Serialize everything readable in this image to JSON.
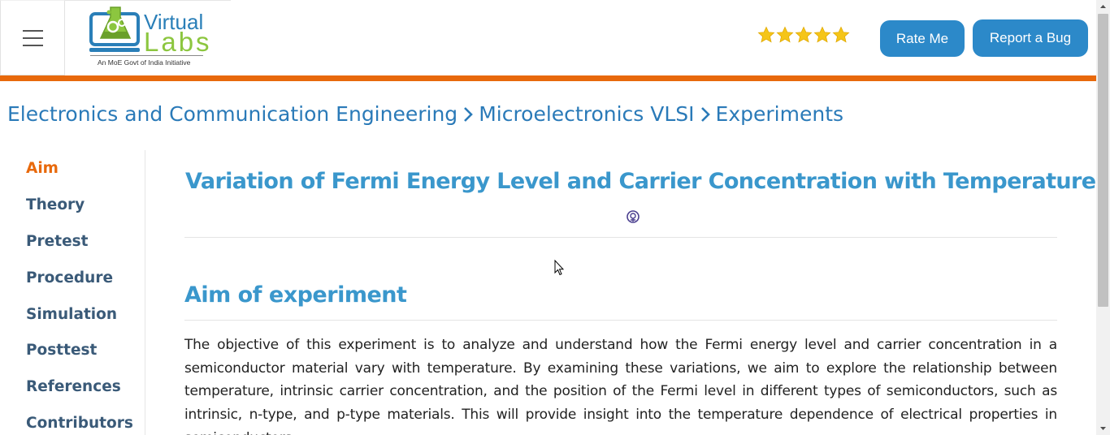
{
  "header": {
    "logo": {
      "word1": "Virtual",
      "word2": "Labs",
      "tagline": "An MoE Govt of India Initiative"
    },
    "rating_stars": 5,
    "rate_button": "Rate Me",
    "bug_button": "Report a Bug",
    "accent_color": "#e8690c",
    "button_color": "#2c89c9"
  },
  "breadcrumb": {
    "items": [
      "Electronics and Communication Engineering",
      "Microelectronics VLSI",
      "Experiments"
    ]
  },
  "sidebar": {
    "items": [
      {
        "label": "Aim",
        "active": true
      },
      {
        "label": "Theory",
        "active": false
      },
      {
        "label": "Pretest",
        "active": false
      },
      {
        "label": "Procedure",
        "active": false
      },
      {
        "label": "Simulation",
        "active": false
      },
      {
        "label": "Posttest",
        "active": false
      },
      {
        "label": "References",
        "active": false
      },
      {
        "label": "Contributors",
        "active": false
      }
    ]
  },
  "main": {
    "title": "Variation of Fermi Energy Level and Carrier Concentration with Temperature",
    "section_title": "Aim of experiment",
    "paragraph": "The objective of this experiment is to analyze and understand how the Fermi energy level and carrier concentration in a semiconductor material vary with temperature. By examining these variations, we aim to explore the relationship between temperature, intrinsic carrier concentration, and the position of the Fermi level in different types of semiconductors, such as intrinsic, n-type, and p-type materials. This will provide insight into the temperature dependence of electrical properties in semiconductors."
  }
}
